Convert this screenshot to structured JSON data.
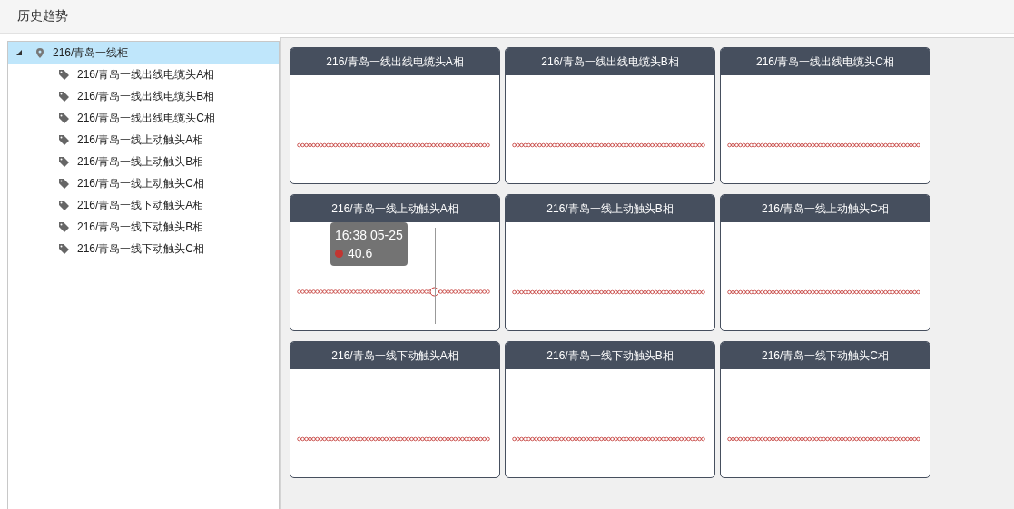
{
  "page_title": "历史趋势",
  "tree": {
    "label": "216/青岛一线柜",
    "expanded": true,
    "selected": true,
    "children": [
      {
        "label": "216/青岛一线出线电缆头A相"
      },
      {
        "label": "216/青岛一线出线电缆头B相"
      },
      {
        "label": "216/青岛一线出线电缆头C相"
      },
      {
        "label": "216/青岛一线上动触头A相"
      },
      {
        "label": "216/青岛一线上动触头B相"
      },
      {
        "label": "216/青岛一线上动触头C相"
      },
      {
        "label": "216/青岛一线下动触头A相"
      },
      {
        "label": "216/青岛一线下动触头B相"
      },
      {
        "label": "216/青岛一线下动触头C相"
      }
    ]
  },
  "cards": [
    {
      "title": "216/青岛一线出线电缆头A相"
    },
    {
      "title": "216/青岛一线出线电缆头B相"
    },
    {
      "title": "216/青岛一线出线电缆头C相"
    },
    {
      "title": "216/青岛一线上动触头A相",
      "tooltip": {
        "time": "16:38 05-25",
        "value": "40.6"
      }
    },
    {
      "title": "216/青岛一线上动触头B相"
    },
    {
      "title": "216/青岛一线上动触头C相"
    },
    {
      "title": "216/青岛一线下动触头A相"
    },
    {
      "title": "216/青岛一线下动触头B相"
    },
    {
      "title": "216/青岛一线下动触头C相"
    }
  ]
}
